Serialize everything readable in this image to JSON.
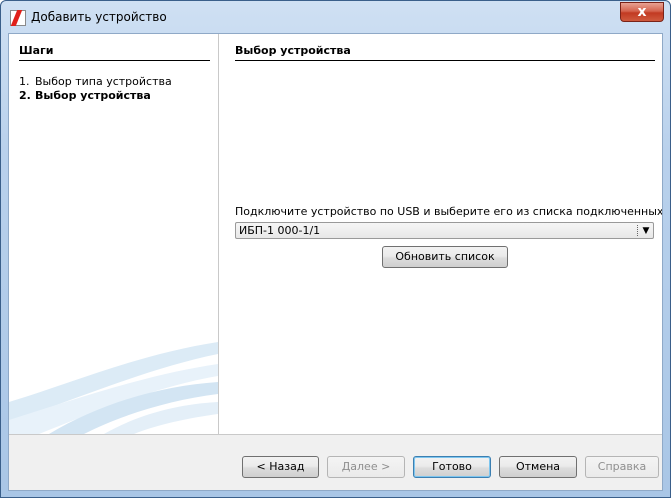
{
  "window": {
    "title": "Добавить устройство",
    "icon": "app-logo-icon",
    "close_label": "x"
  },
  "steps": {
    "heading": "Шаги",
    "items": [
      {
        "num": "1.",
        "label": "Выбор типа устройства",
        "current": false
      },
      {
        "num": "2.",
        "label": "Выбор устройства",
        "current": true
      }
    ]
  },
  "main": {
    "title": "Выбор устройства",
    "prompt": "Подключите устройство по USB и выберите его из списка подключенных:",
    "device_select": {
      "value": "ИБП-1 000-1/1",
      "arrow": "▼"
    },
    "refresh_label": "Обновить список"
  },
  "footer": {
    "back_label": "< Назад",
    "next_label": "Далее >",
    "finish_label": "Готово",
    "cancel_label": "Отмена",
    "help_label": "Справка"
  },
  "colors": {
    "titlebar": "#b9d1ec",
    "close": "#c23a22",
    "accent_logo": "#e0201a",
    "footer": "#f0f0f0",
    "default_button_border": "#3c7fb1"
  }
}
